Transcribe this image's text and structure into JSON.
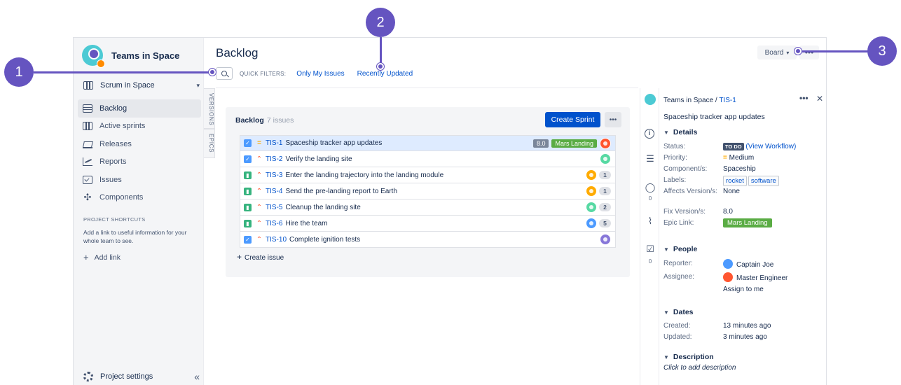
{
  "sidebar": {
    "project_name": "Teams in Space",
    "board_select": "Scrum in Space",
    "nav": [
      {
        "label": "Backlog",
        "icon": "backlog-icon",
        "active": true
      },
      {
        "label": "Active sprints",
        "icon": "board-icon"
      },
      {
        "label": "Releases",
        "icon": "ship-icon"
      },
      {
        "label": "Reports",
        "icon": "chart-icon"
      },
      {
        "label": "Issues",
        "icon": "issues-icon"
      },
      {
        "label": "Components",
        "icon": "puzzle-icon"
      }
    ],
    "shortcuts_title": "PROJECT SHORTCUTS",
    "shortcuts_desc": "Add a link to useful information for your whole team to see.",
    "add_link": "Add link",
    "project_settings": "Project settings",
    "collapse_glyph": "«"
  },
  "vtabs": [
    "VERSIONS",
    "EPICS"
  ],
  "main": {
    "title": "Backlog",
    "quick_filters_label": "QUICK FILTERS:",
    "quick_filters": [
      "Only My Issues",
      "Recently Updated"
    ],
    "board_button": "Board",
    "more_button": "•••"
  },
  "backlog": {
    "title": "Backlog",
    "count": "7 issues",
    "create_sprint": "Create Sprint",
    "more": "•••",
    "create_issue": "Create issue",
    "issues": [
      {
        "key": "TIS-1",
        "summary": "Spaceship tracker app updates",
        "type": "task",
        "priority": "medium",
        "estimate": "8.0",
        "epic": "Mars Landing",
        "avatar": "red",
        "points": "",
        "selected": true
      },
      {
        "key": "TIS-2",
        "summary": "Verify the landing site",
        "type": "task",
        "priority": "high",
        "estimate": "",
        "epic": "",
        "avatar": "teal",
        "points": ""
      },
      {
        "key": "TIS-3",
        "summary": "Enter the landing trajectory into the landing module",
        "type": "story",
        "priority": "high",
        "estimate": "",
        "epic": "",
        "avatar": "orange",
        "points": "1"
      },
      {
        "key": "TIS-4",
        "summary": "Send the pre-landing report to Earth",
        "type": "story",
        "priority": "high",
        "estimate": "",
        "epic": "",
        "avatar": "orange",
        "points": "1"
      },
      {
        "key": "TIS-5",
        "summary": "Cleanup the landing site",
        "type": "story",
        "priority": "high",
        "estimate": "",
        "epic": "",
        "avatar": "teal",
        "points": "2"
      },
      {
        "key": "TIS-6",
        "summary": "Hire the team",
        "type": "story",
        "priority": "high",
        "estimate": "",
        "epic": "",
        "avatar": "blue",
        "points": "5"
      },
      {
        "key": "TIS-10",
        "summary": "Complete ignition tests",
        "type": "task",
        "priority": "high",
        "estimate": "",
        "epic": "",
        "avatar": "purple",
        "points": ""
      }
    ]
  },
  "icon_column": {
    "comments_count": "0",
    "subtasks_count": "0"
  },
  "detail": {
    "project": "Teams in Space",
    "separator": " / ",
    "key": "TIS-1",
    "more": "•••",
    "close": "✕",
    "summary": "Spaceship tracker app updates",
    "details_title": "Details",
    "status_label": "Status:",
    "status_value": "TO DO",
    "view_workflow_open": "(",
    "view_workflow": "View Workflow",
    "view_workflow_close": ")",
    "priority_label": "Priority:",
    "priority_value": "Medium",
    "components_label": "Component/s:",
    "components_value": "Spaceship",
    "labels_label": "Labels:",
    "labels": [
      "rocket",
      "software"
    ],
    "affects_label": "Affects Version/s:",
    "affects_value": "None",
    "fix_label": "Fix Version/s:",
    "fix_value": "8.0",
    "epic_label": "Epic Link:",
    "epic_value": "Mars Landing",
    "people_title": "People",
    "reporter_label": "Reporter:",
    "reporter_value": "Captain Joe",
    "assignee_label": "Assignee:",
    "assignee_value": "Master Engineer",
    "assign_to_me": "Assign to me",
    "dates_title": "Dates",
    "created_label": "Created:",
    "created_value": "13 minutes ago",
    "updated_label": "Updated:",
    "updated_value": "3 minutes ago",
    "description_title": "Description",
    "description_placeholder": "Click to add description"
  },
  "callouts": [
    "1",
    "2",
    "3"
  ],
  "colors": {
    "accent": "#0052cc",
    "callout": "#6554c0",
    "epic": "#5aac44"
  }
}
